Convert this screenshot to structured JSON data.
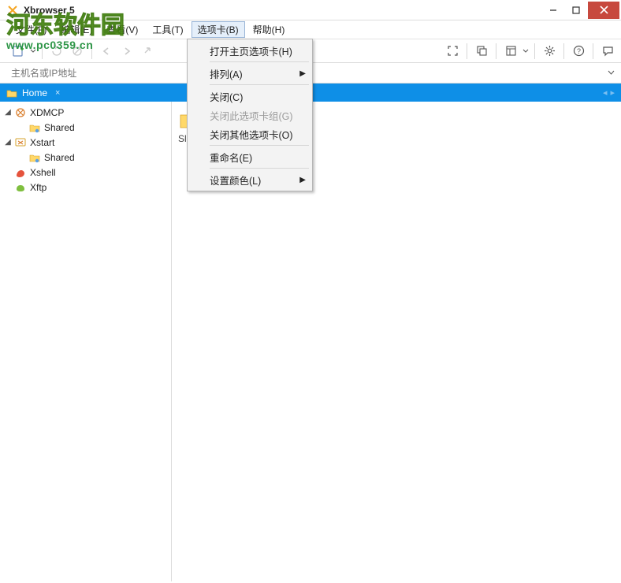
{
  "window": {
    "title": "Xbrowser 5"
  },
  "menubar": {
    "items": [
      {
        "label": "文件(F)"
      },
      {
        "label": "编辑(E)"
      },
      {
        "label": "查看(V)"
      },
      {
        "label": "工具(T)"
      },
      {
        "label": "选项卡(B)",
        "active": true
      },
      {
        "label": "帮助(H)"
      }
    ]
  },
  "addressbar": {
    "placeholder": "主机名或IP地址"
  },
  "tabs": {
    "items": [
      {
        "label": "Home"
      }
    ]
  },
  "tree": {
    "xdmcp": {
      "label": "XDMCP",
      "shared": "Shared"
    },
    "xstart": {
      "label": "Xstart",
      "shared": "Shared"
    },
    "xshell": {
      "label": "Xshell"
    },
    "xftp": {
      "label": "Xftp"
    }
  },
  "main_peek": "Sl",
  "dropdown": {
    "open_home": "打开主页选项卡(H)",
    "arrange": "排列(A)",
    "close": "关闭(C)",
    "close_group": "关闭此选项卡组(G)",
    "close_others": "关闭其他选项卡(O)",
    "rename": "重命名(E)",
    "set_color": "设置颜色(L)"
  },
  "watermark": {
    "line1": "河东软件园",
    "line2": "www.pc0359.cn"
  }
}
